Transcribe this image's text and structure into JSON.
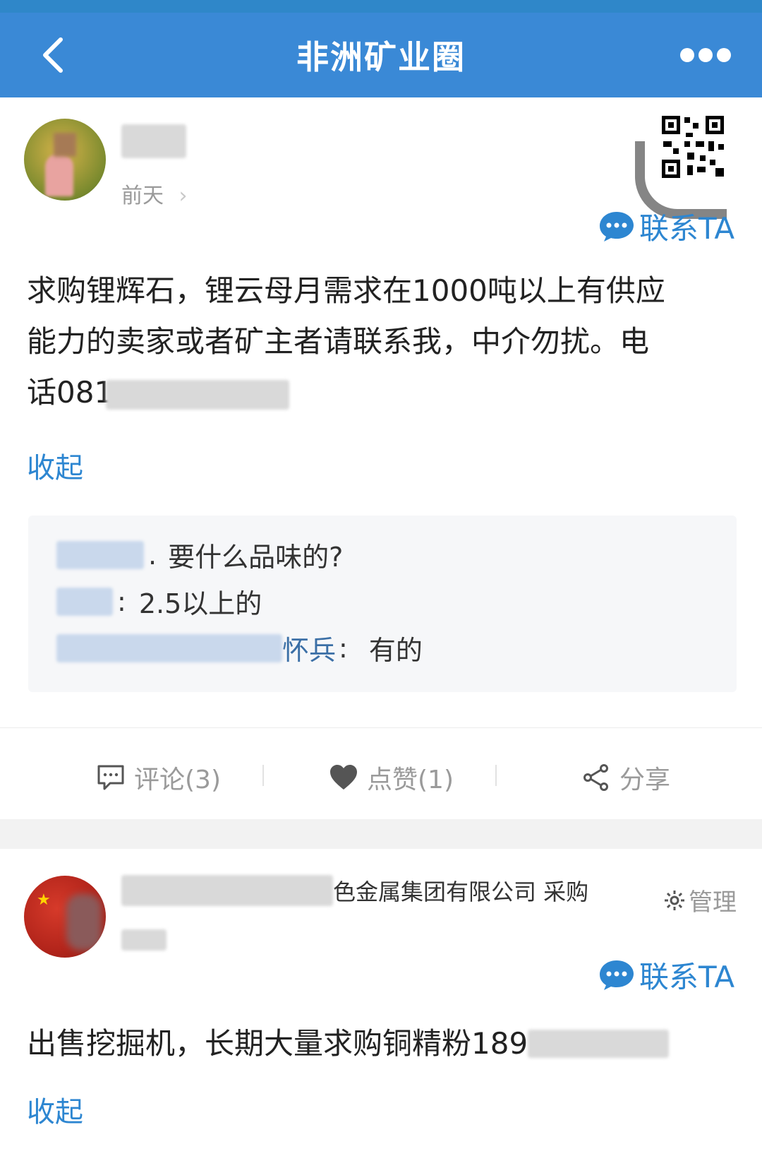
{
  "header": {
    "title": "非洲矿业圈"
  },
  "post1": {
    "time": "前天",
    "contact_label": "联系TA",
    "content_line1": "求购锂辉石，锂云母月需求在1000吨以上有供应",
    "content_line2": "能力的卖家或者矿主者请联系我，中介勿扰。电",
    "content_line3": "话081",
    "collapse_label": "收起",
    "comments": [
      {
        "text": "要什么品味的?"
      },
      {
        "text": "2.5以上的"
      },
      {
        "name_tail": "怀兵",
        "text": "有的"
      }
    ]
  },
  "actions": {
    "comment_label": "评论(3)",
    "like_label": "点赞(1)",
    "share_label": "分享"
  },
  "post2": {
    "author_suffix": "色金属集团有限公司 采购",
    "manage_label": "管理",
    "contact_label": "联系TA",
    "content": "出售挖掘机，长期大量求购铜精粉189",
    "collapse_label": "收起"
  }
}
